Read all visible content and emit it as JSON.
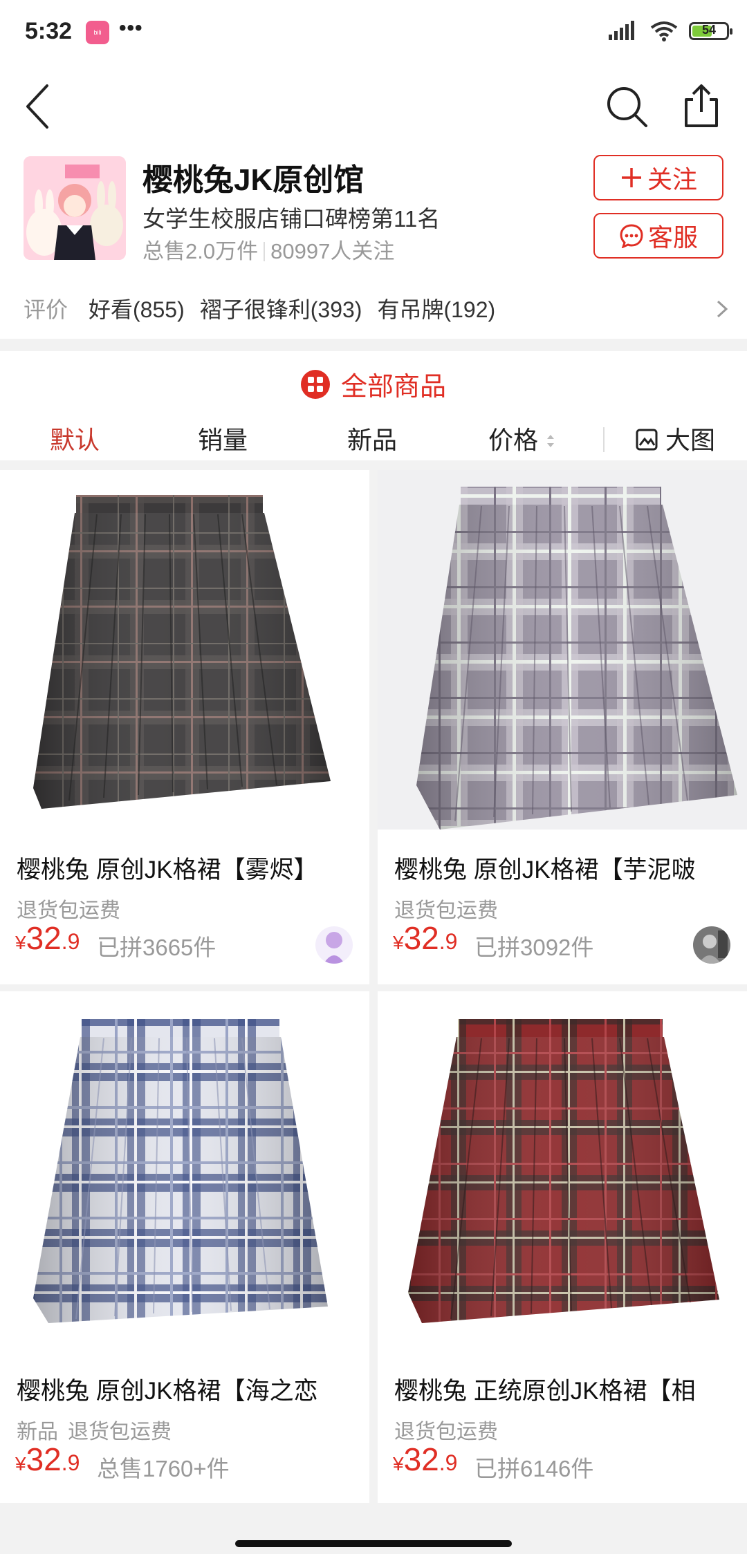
{
  "status_bar": {
    "time": "5:32",
    "app_icon": "bilibili",
    "more": "•••",
    "battery": "54"
  },
  "nav": {
    "back_icon": "chevron-left-icon",
    "search_icon": "search-icon",
    "share_icon": "share-icon"
  },
  "shop": {
    "name": "樱桃兔JK原创馆",
    "rank": "女学生校服店铺口碑榜第11名",
    "sales": "总售2.0万件",
    "followers": "80997人关注",
    "follow_label": "关注",
    "service_label": "客服",
    "reviews_label": "评价",
    "review_tags": [
      "好看(855)",
      "褶子很锋利(393)",
      "有吊牌(192)"
    ]
  },
  "section": {
    "title": "全部商品",
    "sorts": [
      "默认",
      "销量",
      "新品",
      "价格",
      "大图"
    ]
  },
  "products": [
    {
      "title": "樱桃兔  原创JK格裙【雾烬】",
      "tags": [
        "退货包运费"
      ],
      "currency": "¥",
      "price_int": "32",
      "price_dec": ".9",
      "sales": "已拼3665件"
    },
    {
      "title": "樱桃兔  原创JK格裙【芋泥啵",
      "tags": [
        "退货包运费"
      ],
      "currency": "¥",
      "price_int": "32",
      "price_dec": ".9",
      "sales": "已拼3092件"
    },
    {
      "title": "樱桃兔 原创JK格裙【海之恋",
      "tags": [
        "新品",
        "退货包运费"
      ],
      "currency": "¥",
      "price_int": "32",
      "price_dec": ".9",
      "sales": "总售1760+件"
    },
    {
      "title": "樱桃兔 正统原创JK格裙【相",
      "tags": [
        "退货包运费"
      ],
      "currency": "¥",
      "price_int": "32",
      "price_dec": ".9",
      "sales": "已拼6146件"
    }
  ],
  "colors": {
    "accent": "#e02e24",
    "skirt_dark": "#3c3a3b",
    "skirt_lilac": "#a69fae",
    "skirt_navy": "#3e4f86",
    "skirt_red": "#8e2a2c"
  }
}
